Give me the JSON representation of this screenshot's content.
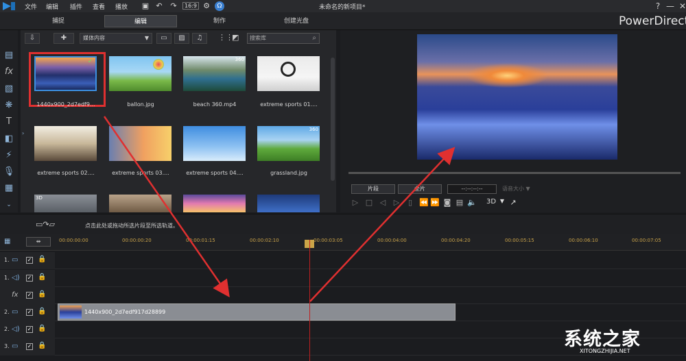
{
  "menubar": {
    "items": [
      "文件",
      "编辑",
      "插件",
      "查看",
      "播放"
    ],
    "aspect": "16:9",
    "title": "未命名的新项目*",
    "help": "?",
    "minimize": "—",
    "close": "✕"
  },
  "modes": {
    "tabs": [
      "捕捉",
      "编辑",
      "制作",
      "创建光盘"
    ],
    "active": "编辑",
    "brand": "PowerDirecto"
  },
  "library": {
    "media_type": "媒体内容",
    "search_placeholder": "搜索库",
    "items": [
      {
        "label": "1440x900_2d7edf9...",
        "badge": ""
      },
      {
        "label": "ballon.jpg",
        "badge": ""
      },
      {
        "label": "beach 360.mp4",
        "badge": "360"
      },
      {
        "label": "extreme sports 01....",
        "badge": ""
      },
      {
        "label": "extreme sports 02....",
        "badge": ""
      },
      {
        "label": "extreme sports 03....",
        "badge": ""
      },
      {
        "label": "extreme sports 04....",
        "badge": ""
      },
      {
        "label": "grassland.jpg",
        "badge": "360"
      },
      {
        "label": "",
        "badge": "3D"
      },
      {
        "label": "",
        "badge": ""
      },
      {
        "label": "",
        "badge": ""
      },
      {
        "label": "",
        "badge": ""
      }
    ]
  },
  "preview": {
    "clip_button": "片段",
    "movie_button": "全片",
    "timecode": "--:--:--:--",
    "size_label": "语音大小",
    "mode_3d": "3D"
  },
  "timeline": {
    "hint": "点击此处或拖动所选片段至所选轨道。",
    "ticks": [
      "00:00:00:00",
      "00:00:00:20",
      "00:00:01:15",
      "00:00:02:10",
      "00:00:03:05",
      "00:00:04:00",
      "00:00:04:20",
      "00:00:05:15",
      "00:00:06:10",
      "00:00:07:05"
    ],
    "tracks": [
      {
        "num": "1.",
        "icon": "video-track-icon"
      },
      {
        "num": "1.",
        "icon": "audio-track-icon"
      },
      {
        "num": "",
        "icon": "fx-track-icon"
      },
      {
        "num": "2.",
        "icon": "video-track-icon"
      },
      {
        "num": "2.",
        "icon": "audio-track-icon"
      },
      {
        "num": "3.",
        "icon": "video-track-icon"
      }
    ],
    "clip_label": "1440x900_2d7edf917d28899"
  },
  "watermark": {
    "text": "系统之家",
    "url": "XITONGZHIJIA.NET"
  }
}
